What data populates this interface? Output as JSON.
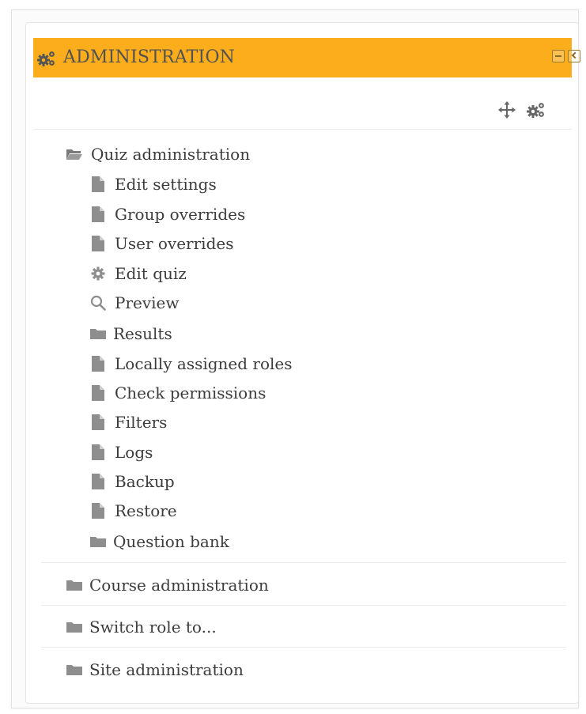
{
  "block": {
    "title": "ADMINISTRATION",
    "header_color": "#fbad1c"
  },
  "controls": {
    "move_icon": "move-arrows-icon",
    "config_icon": "gears-icon"
  },
  "nav": {
    "quiz_admin": {
      "label": "Quiz administration",
      "icon": "folder-open-icon",
      "expanded": true,
      "items": [
        {
          "label": "Edit settings",
          "icon": "file-icon"
        },
        {
          "label": "Group overrides",
          "icon": "file-icon"
        },
        {
          "label": "User overrides",
          "icon": "file-icon"
        },
        {
          "label": "Edit quiz",
          "icon": "cog-icon"
        },
        {
          "label": "Preview",
          "icon": "search-icon"
        },
        {
          "label": "Results",
          "icon": "folder-icon"
        },
        {
          "label": "Locally assigned roles",
          "icon": "file-icon"
        },
        {
          "label": "Check permissions",
          "icon": "file-icon"
        },
        {
          "label": "Filters",
          "icon": "file-icon"
        },
        {
          "label": "Logs",
          "icon": "file-icon"
        },
        {
          "label": "Backup",
          "icon": "file-icon"
        },
        {
          "label": "Restore",
          "icon": "file-icon"
        },
        {
          "label": "Question bank",
          "icon": "folder-icon"
        }
      ]
    },
    "sections": [
      {
        "label": "Course administration",
        "icon": "folder-icon"
      },
      {
        "label": "Switch role to...",
        "icon": "folder-icon"
      },
      {
        "label": "Site administration",
        "icon": "folder-icon"
      }
    ]
  }
}
